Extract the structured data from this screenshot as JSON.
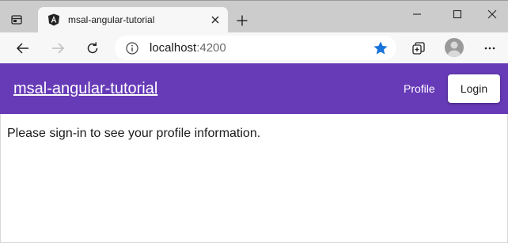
{
  "browser": {
    "tab": {
      "title": "msal-angular-tutorial",
      "favicon": "angular-logo-icon"
    },
    "address": {
      "host": "localhost",
      "port": ":4200"
    },
    "colors": {
      "favorite_star": "#1a73d9",
      "tabstrip": "#cccccc",
      "toolbar": "#f7f7f7"
    }
  },
  "app": {
    "title": "msal-angular-tutorial",
    "nav": {
      "profile_label": "Profile",
      "login_label": "Login"
    },
    "colors": {
      "header": "#673ab7",
      "header_text": "#ffffff"
    }
  },
  "content": {
    "message": "Please sign-in to see your profile information."
  }
}
